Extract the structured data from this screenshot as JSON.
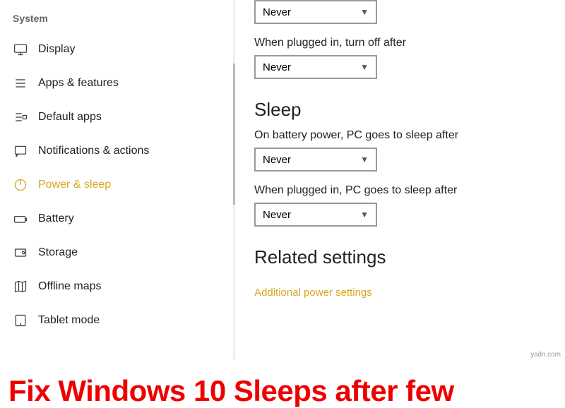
{
  "sidebar": {
    "title": "System",
    "items": [
      {
        "label": "Display"
      },
      {
        "label": "Apps & features"
      },
      {
        "label": "Default apps"
      },
      {
        "label": "Notifications & actions"
      },
      {
        "label": "Power & sleep"
      },
      {
        "label": "Battery"
      },
      {
        "label": "Storage"
      },
      {
        "label": "Offline maps"
      },
      {
        "label": "Tablet mode"
      }
    ]
  },
  "main": {
    "dropdown0_value": "Never",
    "screen_plugged_label": "When plugged in, turn off after",
    "screen_plugged_value": "Never",
    "sleep_heading": "Sleep",
    "sleep_battery_label": "On battery power, PC goes to sleep after",
    "sleep_battery_value": "Never",
    "sleep_plugged_label": "When plugged in, PC goes to sleep after",
    "sleep_plugged_value": "Never",
    "related_heading": "Related settings",
    "related_link": "Additional power settings"
  },
  "footer": "Fix Windows 10 Sleeps after few",
  "watermark": "ysdn.com"
}
